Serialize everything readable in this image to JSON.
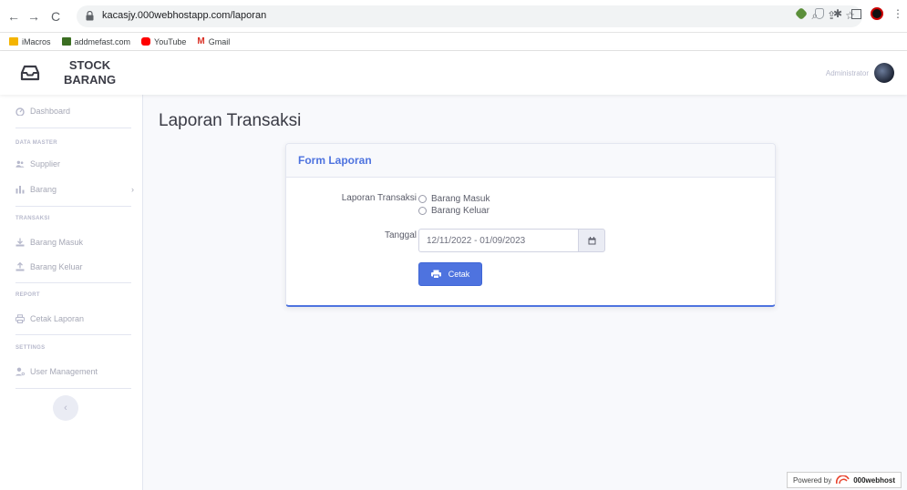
{
  "browser": {
    "url": "kacasjy.000webhostapp.com/laporan",
    "bookmarks": [
      {
        "label": "iMacros",
        "color": "#f4b400"
      },
      {
        "label": "addmefast.com",
        "color": "#3b6e22"
      },
      {
        "label": "YouTube",
        "color": "#ff0000"
      },
      {
        "label": "Gmail",
        "color": "#d93025"
      }
    ]
  },
  "header": {
    "brand_line1": "STOCK",
    "brand_line2": "BARANG",
    "user_name": "Administrator"
  },
  "sidebar": {
    "dashboard": "Dashboard",
    "section_data_master": "DATA MASTER",
    "supplier": "Supplier",
    "barang": "Barang",
    "section_transaksi": "TRANSAKSI",
    "barang_masuk": "Barang Masuk",
    "barang_keluar": "Barang Keluar",
    "section_report": "REPORT",
    "cetak_laporan": "Cetak Laporan",
    "section_settings": "SETTINGS",
    "user_management": "User Management"
  },
  "main": {
    "page_title": "Laporan Transaksi",
    "card_title": "Form Laporan",
    "label_laporan": "Laporan Transaksi",
    "option_masuk": "Barang Masuk",
    "option_keluar": "Barang Keluar",
    "label_tanggal": "Tanggal",
    "date_range": "12/11/2022 - 01/09/2023",
    "button_cetak": "Cetak"
  },
  "footer": {
    "powered_by": "Powered by",
    "host": "000webhost"
  },
  "colors": {
    "primary": "#4e73df",
    "sidebar_text": "#a6a8b6"
  }
}
